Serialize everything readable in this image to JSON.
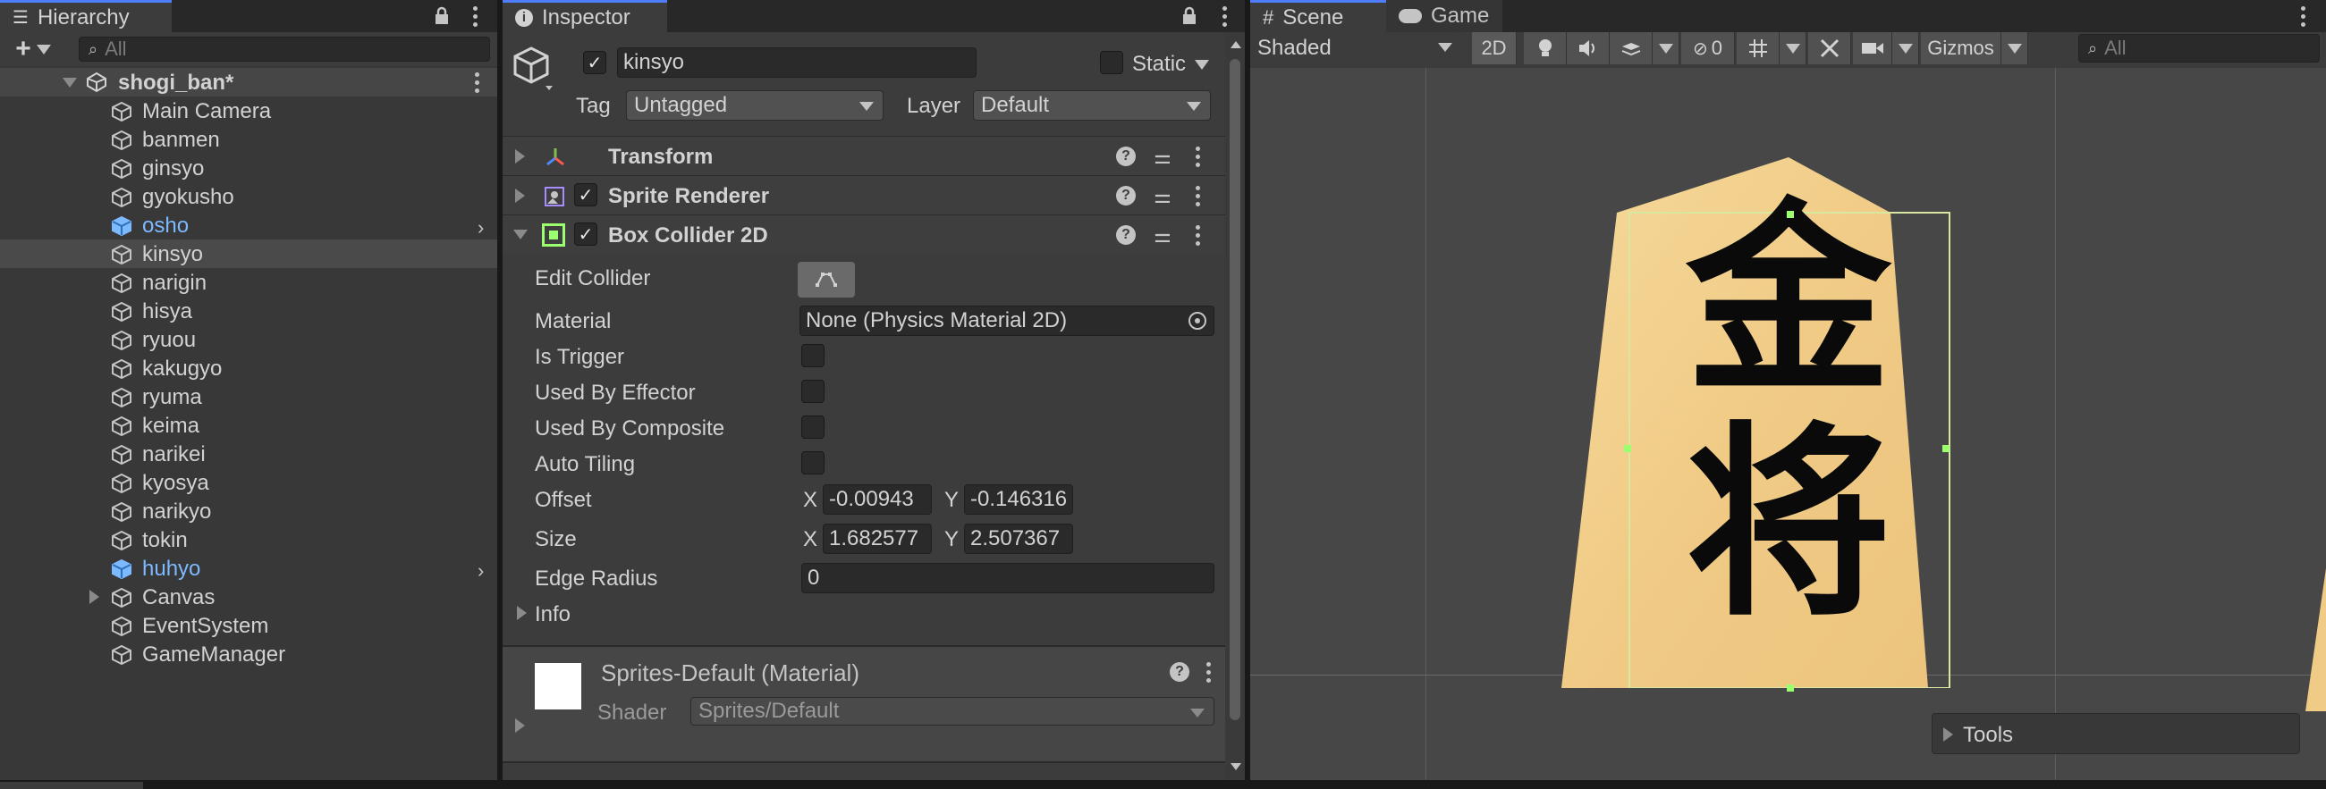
{
  "hierarchy": {
    "tab_label": "Hierarchy",
    "search_placeholder": "All",
    "scene_name": "shogi_ban*",
    "items": [
      {
        "label": "Main Camera",
        "prefab": false
      },
      {
        "label": "banmen",
        "prefab": false
      },
      {
        "label": "ginsyo",
        "prefab": false
      },
      {
        "label": "gyokusho",
        "prefab": false
      },
      {
        "label": "osho",
        "prefab": true
      },
      {
        "label": "kinsyo",
        "prefab": false,
        "selected": true
      },
      {
        "label": "narigin",
        "prefab": false
      },
      {
        "label": "hisya",
        "prefab": false
      },
      {
        "label": "ryuou",
        "prefab": false
      },
      {
        "label": "kakugyo",
        "prefab": false
      },
      {
        "label": "ryuma",
        "prefab": false
      },
      {
        "label": "keima",
        "prefab": false
      },
      {
        "label": "narikei",
        "prefab": false
      },
      {
        "label": "kyosya",
        "prefab": false
      },
      {
        "label": "narikyo",
        "prefab": false
      },
      {
        "label": "tokin",
        "prefab": false
      },
      {
        "label": "huhyo",
        "prefab": true
      },
      {
        "label": "Canvas",
        "prefab": false
      },
      {
        "label": "EventSystem",
        "prefab": false
      },
      {
        "label": "GameManager",
        "prefab": false
      }
    ]
  },
  "inspector": {
    "tab_label": "Inspector",
    "object_name": "kinsyo",
    "static_label": "Static",
    "tag_label": "Tag",
    "tag_value": "Untagged",
    "layer_label": "Layer",
    "layer_value": "Default",
    "components": {
      "transform": "Transform",
      "sprite_renderer": "Sprite Renderer",
      "box_collider": "Box Collider 2D"
    },
    "collider": {
      "edit_collider": "Edit Collider",
      "material_label": "Material",
      "material_value": "None (Physics Material 2D)",
      "is_trigger": "Is Trigger",
      "used_by_effector": "Used By Effector",
      "used_by_composite": "Used By Composite",
      "auto_tiling": "Auto Tiling",
      "offset_label": "Offset",
      "offset_x": "-0.00943",
      "offset_y": "-0.146316",
      "size_label": "Size",
      "size_x": "1.682577",
      "size_y": "2.507367",
      "edge_radius_label": "Edge Radius",
      "edge_radius_value": "0",
      "info_label": "Info",
      "x_label": "X",
      "y_label": "Y"
    },
    "material": {
      "name": "Sprites-Default (Material)",
      "shader_label": "Shader",
      "shader_value": "Sprites/Default"
    }
  },
  "scene": {
    "tab_scene": "Scene",
    "tab_game": "Game",
    "shading_mode": "Shaded",
    "mode_2d": "2D",
    "hidden_count": "0",
    "gizmos_label": "Gizmos",
    "search_placeholder": "All",
    "tools_label": "Tools",
    "piece_glyph_top": "金",
    "piece_glyph_bottom": "将"
  },
  "colors": {
    "accent": "#4c7eff",
    "prefab_blue": "#7db9ff",
    "collider_green": "#9cff70",
    "piece_wood": "#f2cf8d"
  }
}
